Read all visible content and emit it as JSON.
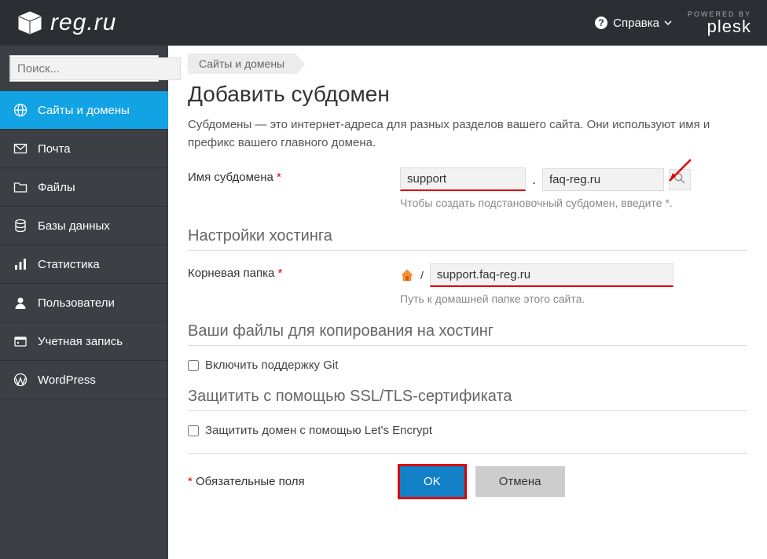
{
  "header": {
    "logo_text": "reg.ru",
    "help_label": "Справка",
    "powered_small": "POWERED BY",
    "powered_brand": "plesk"
  },
  "search": {
    "placeholder": "Поиск..."
  },
  "sidebar": {
    "items": [
      {
        "label": "Сайты и домены",
        "icon": "globe-icon",
        "active": true
      },
      {
        "label": "Почта",
        "icon": "mail-icon",
        "active": false
      },
      {
        "label": "Файлы",
        "icon": "folder-icon",
        "active": false
      },
      {
        "label": "Базы данных",
        "icon": "database-icon",
        "active": false
      },
      {
        "label": "Статистика",
        "icon": "stats-icon",
        "active": false
      },
      {
        "label": "Пользователи",
        "icon": "user-icon",
        "active": false
      },
      {
        "label": "Учетная запись",
        "icon": "account-icon",
        "active": false
      },
      {
        "label": "WordPress",
        "icon": "wordpress-icon",
        "active": false
      }
    ]
  },
  "breadcrumb": "Сайты и домены",
  "page": {
    "title": "Добавить субдомен",
    "description": "Субдомены — это интернет-адреса для разных разделов вашего сайта. Они используют имя и префикс вашего главного домена."
  },
  "form": {
    "subdomain_label": "Имя субдомена",
    "subdomain_value": "support",
    "domain_value": "faq-reg.ru",
    "subdomain_hint": "Чтобы создать подстановочный субдомен, введите *.",
    "hosting_heading": "Настройки хостинга",
    "root_label": "Корневая папка",
    "root_slash": "/",
    "root_value": "support.faq-reg.ru",
    "root_hint": "Путь к домашней папке этого сайта.",
    "files_heading": "Ваши файлы для копирования на хостинг",
    "git_label": "Включить поддержку Git",
    "ssl_heading": "Защитить с помощью SSL/TLS-сертификата",
    "letsencrypt_label": "Защитить домен с помощью Let's Encrypt",
    "required_note": "Обязательные поля",
    "ok_label": "OK",
    "cancel_label": "Отмена"
  }
}
